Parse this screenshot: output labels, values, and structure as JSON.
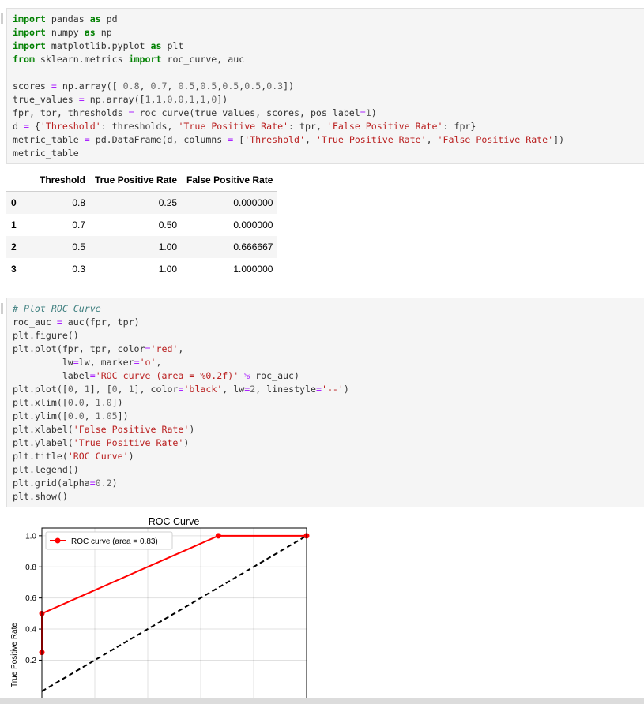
{
  "code_cell_1": {
    "lines": [
      "import pandas as pd",
      "import numpy as np",
      "import matplotlib.pyplot as plt",
      "from sklearn.metrics import roc_curve, auc",
      "",
      "scores = np.array([ 0.8, 0.7, 0.5,0.5,0.5,0.5,0.3])",
      "true_values = np.array([1,1,0,0,1,1,0])",
      "fpr, tpr, thresholds = roc_curve(true_values, scores, pos_label=1)",
      "d = {'Threshold': thresholds, 'True Positive Rate': tpr, 'False Positive Rate': fpr}",
      "metric_table = pd.DataFrame(d, columns = ['Threshold', 'True Positive Rate', 'False Positive Rate'])",
      "metric_table"
    ]
  },
  "dataframe": {
    "columns": [
      "Threshold",
      "True Positive Rate",
      "False Positive Rate"
    ],
    "rows": [
      {
        "index": "0",
        "threshold": "0.8",
        "tpr": "0.25",
        "fpr": "0.000000"
      },
      {
        "index": "1",
        "threshold": "0.7",
        "tpr": "0.50",
        "fpr": "0.000000"
      },
      {
        "index": "2",
        "threshold": "0.5",
        "tpr": "1.00",
        "fpr": "0.666667"
      },
      {
        "index": "3",
        "threshold": "0.3",
        "tpr": "1.00",
        "fpr": "1.000000"
      }
    ]
  },
  "code_cell_2": {
    "lines": [
      "# Plot ROC Curve",
      "roc_auc = auc(fpr, tpr)",
      "plt.figure()",
      "plt.plot(fpr, tpr, color='red',",
      "         lw=lw, marker='o',",
      "         label='ROC curve (area = %0.2f)' % roc_auc)",
      "plt.plot([0, 1], [0, 1], color='black', lw=2, linestyle='--')",
      "plt.xlim([0.0, 1.0])",
      "plt.ylim([0.0, 1.05])",
      "plt.xlabel('False Positive Rate')",
      "plt.ylabel('True Positive Rate')",
      "plt.title('ROC Curve')",
      "plt.legend()",
      "plt.grid(alpha=0.2)",
      "plt.show()"
    ]
  },
  "chart_data": {
    "type": "line",
    "title": "ROC Curve",
    "xlabel": "False Positive Rate",
    "ylabel": "True Positive Rate",
    "xlim": [
      0.0,
      1.0
    ],
    "ylim": [
      0.0,
      1.05
    ],
    "grid": true,
    "legend_position": "top-left",
    "yticks": [
      "0.2",
      "0.4",
      "0.6",
      "0.8",
      "1.0"
    ],
    "series": [
      {
        "name": "ROC curve (area = 0.83)",
        "color": "#ff0000",
        "style": "solid",
        "marker": "o",
        "x": [
          0.0,
          0.0,
          0.666667,
          1.0
        ],
        "y": [
          0.25,
          0.5,
          1.0,
          1.0
        ]
      },
      {
        "name": "",
        "color": "#000000",
        "style": "dashed",
        "marker": "none",
        "x": [
          0.0,
          1.0
        ],
        "y": [
          0.0,
          1.0
        ]
      }
    ]
  }
}
